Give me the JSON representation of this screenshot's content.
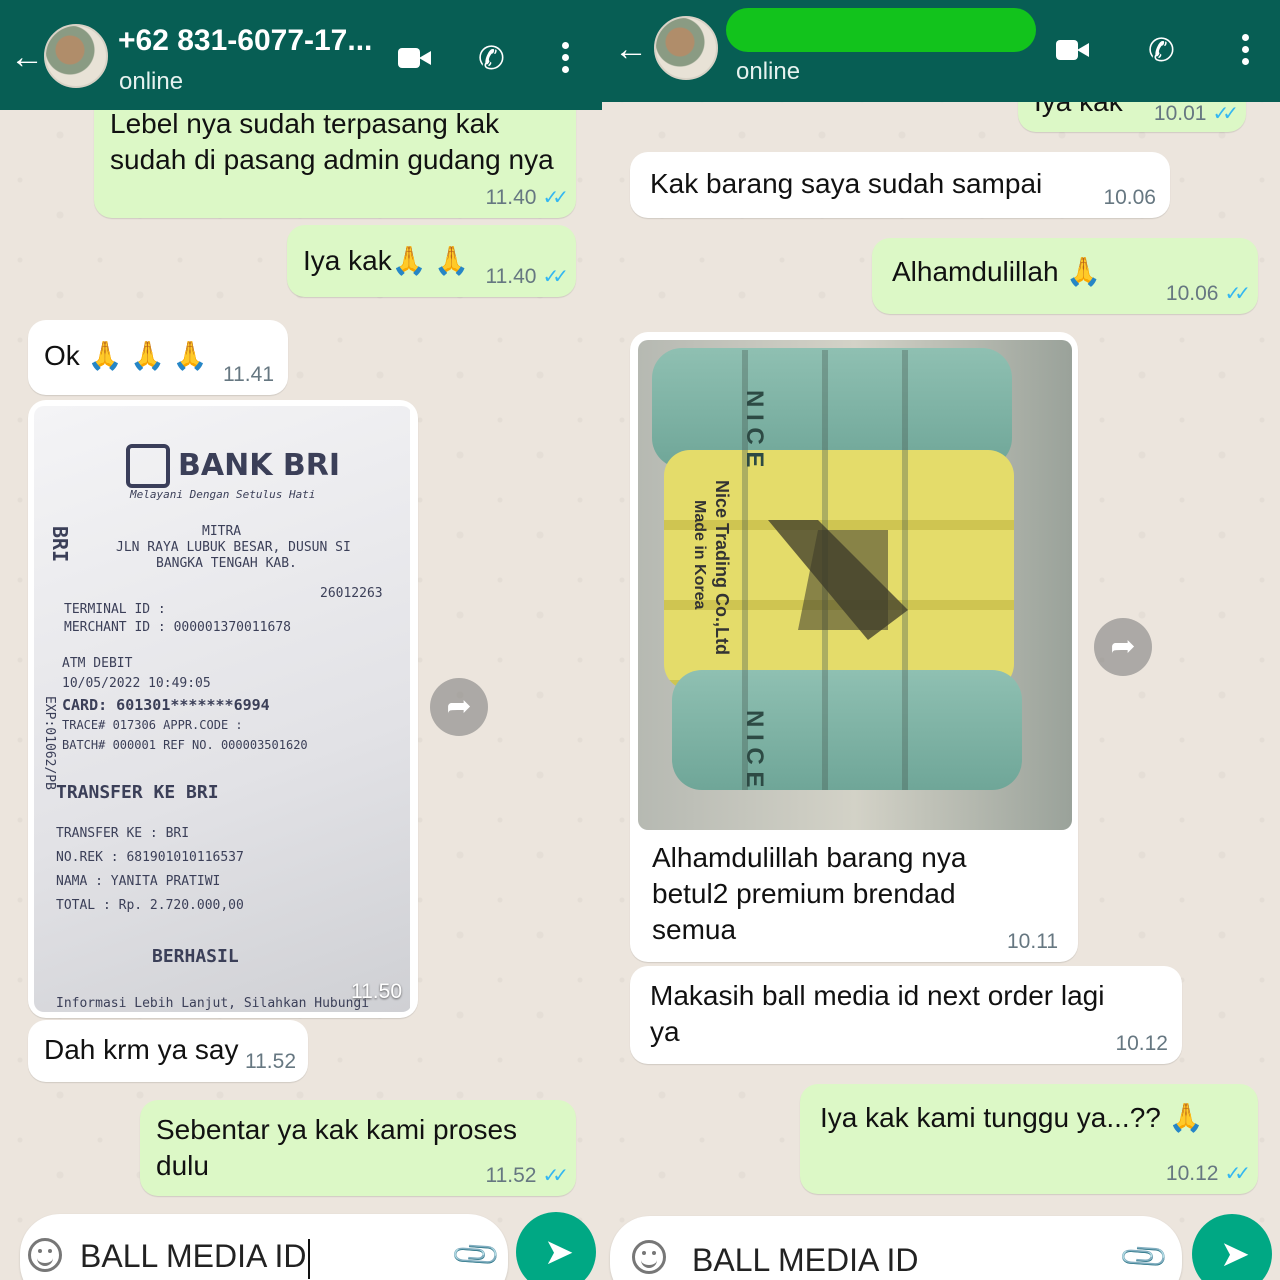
{
  "left": {
    "header": {
      "back_icon": "arrow-left-icon",
      "contact_name": "+62 831-6077-17...",
      "status": "online"
    },
    "messages": [
      {
        "text": "Lebel nya sudah terpasang kak\nsudah di pasang admin gudang nya",
        "time": "11.40",
        "ticks": "✓✓"
      },
      {
        "text": "Iya kak🙏 🙏",
        "time": "11.40",
        "ticks": "✓✓"
      },
      {
        "text": "Ok 🙏 🙏 🙏",
        "time": "11.41"
      },
      {
        "time": "11.50"
      },
      {
        "text": "Dah krm ya say",
        "time": "11.52"
      },
      {
        "text": "Sebentar ya kak kami proses dulu",
        "time": "11.52",
        "ticks": "✓✓"
      }
    ],
    "receipt": {
      "bank": "BANK BRI",
      "tagline": "Melayani Dengan Setulus Hati",
      "side_label": "BRI",
      "side_exp": "EXP:01062/PB",
      "lines": [
        "MITRA",
        "JLN RAYA LUBUK BESAR, DUSUN SI",
        "BANGKA TENGAH KAB.",
        "26012263",
        "TERMINAL ID  :",
        "MERCHANT ID  :      000001370011678",
        "ATM DEBIT",
        "10/05/2022 10:49:05",
        "CARD: 601301*******6994",
        "TRACE# 017306        APPR.CODE :",
        "BATCH# 000001        REF NO.  000003501620",
        "TRANSFER KE BRI",
        "TRANSFER KE     : BRI",
        "NO.REK          : 681901010116537",
        "NAMA            : YANITA PRATIWI",
        "TOTAL           : Rp. 2.720.000,00",
        "BERHASIL",
        "Informasi Lebih Lanjut, Silahkan Hubungi"
      ]
    },
    "input": {
      "value": "BALL MEDIA ID"
    }
  },
  "right": {
    "header": {
      "back_icon": "arrow-left-icon",
      "status": "online"
    },
    "messages": [
      {
        "text": "Iya kak",
        "time": "10.01",
        "ticks": "✓✓"
      },
      {
        "text": "Kak barang saya sudah sampai",
        "time": "10.06"
      },
      {
        "text": "Alhamdulillah 🙏",
        "time": "10.06",
        "ticks": "✓✓"
      },
      {
        "text": "Alhamdulillah barang nya\nbetul2 premium brendad\nsemua",
        "time": "10.11"
      },
      {
        "text": "Makasih ball media id next order lagi\nya",
        "time": "10.12"
      },
      {
        "text": "Iya kak kami tunggu ya...?? 🙏",
        "time": "10.12",
        "ticks": "✓✓"
      }
    ],
    "bale": {
      "print_brand": "Nice Trading Co.,Ltd",
      "print_origin": "Made in Korea",
      "print_letters": "N I C E"
    },
    "input": {
      "value": "BALL MEDIA ID"
    }
  },
  "colors": {
    "header_bg": "#075e54",
    "outgoing_bubble": "#dcf8c6",
    "incoming_bubble": "#ffffff",
    "read_ticks": "#34b7f1",
    "send_button": "#00a884",
    "redaction": "#12c31c"
  }
}
